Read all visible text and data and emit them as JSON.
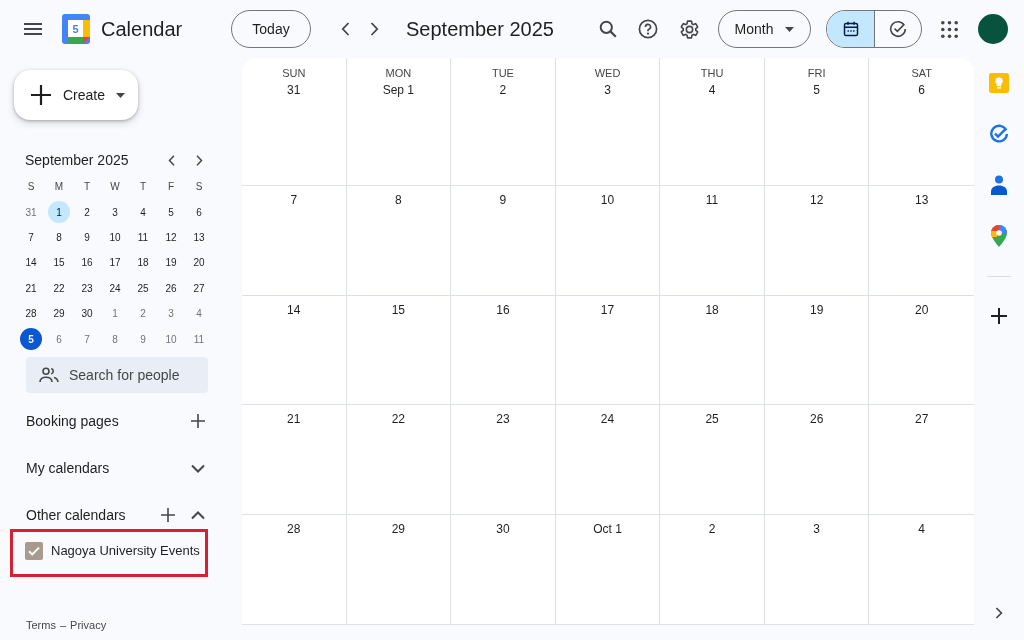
{
  "header": {
    "logo_text": "5",
    "app_name": "Calendar",
    "today_button": "Today",
    "title": "September 2025",
    "view_menu": "Month",
    "view_toggle": [
      {
        "kind": "calendar",
        "selected": true
      },
      {
        "kind": "check",
        "selected": false
      }
    ]
  },
  "sidebar": {
    "create_button": "Create",
    "mini_calendar": {
      "title": "September 2025",
      "weekdays": [
        "S",
        "M",
        "T",
        "W",
        "T",
        "F",
        "S"
      ],
      "weeks": [
        [
          {
            "day": "31",
            "other_month": true,
            "selected": false,
            "today": false
          },
          {
            "day": "1",
            "other_month": false,
            "selected": true,
            "today": false
          },
          {
            "day": "2",
            "other_month": false,
            "selected": false,
            "today": false
          },
          {
            "day": "3",
            "other_month": false,
            "selected": false,
            "today": false
          },
          {
            "day": "4",
            "other_month": false,
            "selected": false,
            "today": false
          },
          {
            "day": "5",
            "other_month": false,
            "selected": false,
            "today": false
          },
          {
            "day": "6",
            "other_month": false,
            "selected": false,
            "today": false
          }
        ],
        [
          {
            "day": "7",
            "other_month": false,
            "selected": false,
            "today": false
          },
          {
            "day": "8",
            "other_month": false,
            "selected": false,
            "today": false
          },
          {
            "day": "9",
            "other_month": false,
            "selected": false,
            "today": false
          },
          {
            "day": "10",
            "other_month": false,
            "selected": false,
            "today": false
          },
          {
            "day": "11",
            "other_month": false,
            "selected": false,
            "today": false
          },
          {
            "day": "12",
            "other_month": false,
            "selected": false,
            "today": false
          },
          {
            "day": "13",
            "other_month": false,
            "selected": false,
            "today": false
          }
        ],
        [
          {
            "day": "14",
            "other_month": false,
            "selected": false,
            "today": false
          },
          {
            "day": "15",
            "other_month": false,
            "selected": false,
            "today": false
          },
          {
            "day": "16",
            "other_month": false,
            "selected": false,
            "today": false
          },
          {
            "day": "17",
            "other_month": false,
            "selected": false,
            "today": false
          },
          {
            "day": "18",
            "other_month": false,
            "selected": false,
            "today": false
          },
          {
            "day": "19",
            "other_month": false,
            "selected": false,
            "today": false
          },
          {
            "day": "20",
            "other_month": false,
            "selected": false,
            "today": false
          }
        ],
        [
          {
            "day": "21",
            "other_month": false,
            "selected": false,
            "today": false
          },
          {
            "day": "22",
            "other_month": false,
            "selected": false,
            "today": false
          },
          {
            "day": "23",
            "other_month": false,
            "selected": false,
            "today": false
          },
          {
            "day": "24",
            "other_month": false,
            "selected": false,
            "today": false
          },
          {
            "day": "25",
            "other_month": false,
            "selected": false,
            "today": false
          },
          {
            "day": "26",
            "other_month": false,
            "selected": false,
            "today": false
          },
          {
            "day": "27",
            "other_month": false,
            "selected": false,
            "today": false
          }
        ],
        [
          {
            "day": "28",
            "other_month": false,
            "selected": false,
            "today": false
          },
          {
            "day": "29",
            "other_month": false,
            "selected": false,
            "today": false
          },
          {
            "day": "30",
            "other_month": false,
            "selected": false,
            "today": false
          },
          {
            "day": "1",
            "other_month": true,
            "selected": false,
            "today": false
          },
          {
            "day": "2",
            "other_month": true,
            "selected": false,
            "today": false
          },
          {
            "day": "3",
            "other_month": true,
            "selected": false,
            "today": false
          },
          {
            "day": "4",
            "other_month": true,
            "selected": false,
            "today": false
          }
        ],
        [
          {
            "day": "5",
            "other_month": true,
            "selected": false,
            "today": true
          },
          {
            "day": "6",
            "other_month": true,
            "selected": false,
            "today": false
          },
          {
            "day": "7",
            "other_month": true,
            "selected": false,
            "today": false
          },
          {
            "day": "8",
            "other_month": true,
            "selected": false,
            "today": false
          },
          {
            "day": "9",
            "other_month": true,
            "selected": false,
            "today": false
          },
          {
            "day": "10",
            "other_month": true,
            "selected": false,
            "today": false
          },
          {
            "day": "11",
            "other_month": true,
            "selected": false,
            "today": false
          }
        ]
      ]
    },
    "people_search": {
      "placeholder": "Search for people"
    },
    "sections": [
      {
        "kind": "plain",
        "title": "Booking pages",
        "add": true
      },
      {
        "kind": "collapsible",
        "title": "My calendars",
        "add": false,
        "expanded": false
      },
      {
        "kind": "collapsible",
        "title": "Other calendars",
        "add": true,
        "expanded": true,
        "items": [
          {
            "label": "Nagoya University Events",
            "checked": true,
            "color": "#a79b8e",
            "highlighted": true
          }
        ]
      }
    ],
    "footer": {
      "links": [
        "Terms",
        "Privacy"
      ],
      "separator": "–"
    }
  },
  "month_grid": {
    "weekdays": [
      "SUN",
      "MON",
      "TUE",
      "WED",
      "THU",
      "FRI",
      "SAT"
    ],
    "weeks": [
      [
        "31",
        "Sep 1",
        "2",
        "3",
        "4",
        "5",
        "6"
      ],
      [
        "7",
        "8",
        "9",
        "10",
        "11",
        "12",
        "13"
      ],
      [
        "14",
        "15",
        "16",
        "17",
        "18",
        "19",
        "20"
      ],
      [
        "21",
        "22",
        "23",
        "24",
        "25",
        "26",
        "27"
      ],
      [
        "28",
        "29",
        "30",
        "Oct 1",
        "2",
        "3",
        "4"
      ]
    ]
  },
  "side_panel": {
    "apps": [
      {
        "kind": "bulb"
      },
      {
        "kind": "check"
      },
      {
        "kind": "person"
      },
      {
        "kind": "pin"
      }
    ]
  }
}
